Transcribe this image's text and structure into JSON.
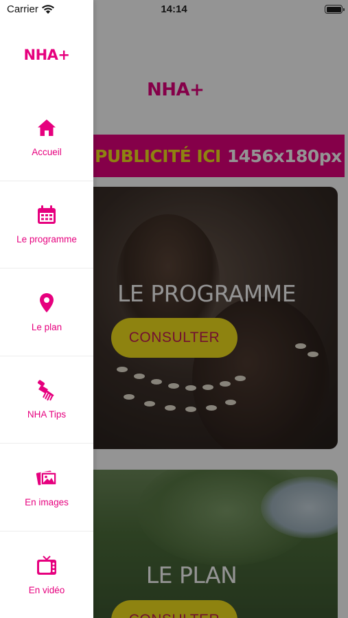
{
  "status_bar": {
    "carrier": "Carrier",
    "time": "14:14",
    "wifi_icon": "wifi-icon",
    "battery_icon": "battery-icon"
  },
  "brand": {
    "name": "NHA+",
    "accent_color": "#e6007e",
    "yellow": "#f4e21d"
  },
  "drawer": {
    "logo": "NHA+",
    "items": [
      {
        "label": "Accueil",
        "icon": "home-icon"
      },
      {
        "label": "Le programme",
        "icon": "calendar-icon"
      },
      {
        "label": "Le plan",
        "icon": "map-pin-icon"
      },
      {
        "label": "NHA Tips",
        "icon": "afro-comb-icon"
      },
      {
        "label": "En images",
        "icon": "photos-icon"
      },
      {
        "label": "En vidéo",
        "icon": "tv-icon"
      }
    ]
  },
  "main": {
    "logo": "NHA+",
    "ad_banner": {
      "text_highlight": "PUBLICITÉ ICI",
      "text_size": "1456x180px"
    },
    "cards": [
      {
        "title": "LE PROGRAMME",
        "button": "CONSULTER"
      },
      {
        "title": "LE PLAN",
        "button": "CONSULTER"
      }
    ]
  }
}
